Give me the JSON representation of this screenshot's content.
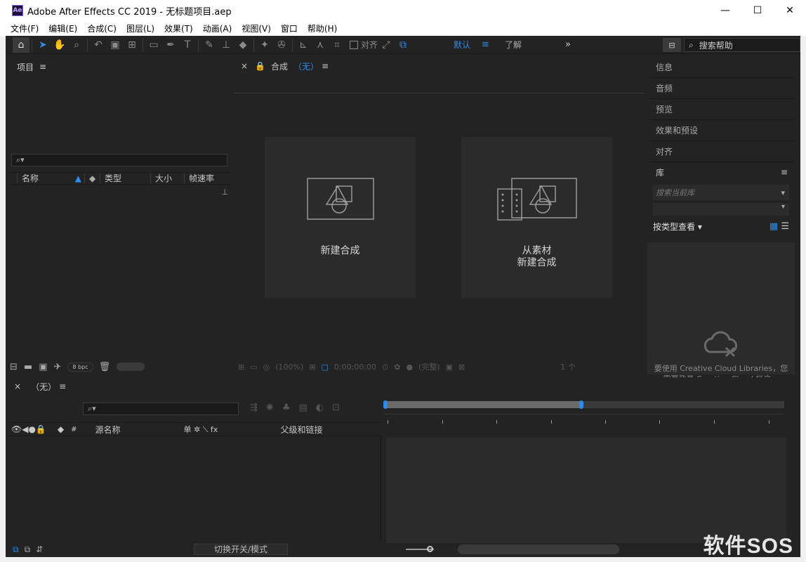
{
  "window": {
    "title": "Adobe After Effects CC 2019 - 无标题项目.aep",
    "app_icon_text": "Ae",
    "minimize": "—",
    "maximize": "☐",
    "close": "✕"
  },
  "menu": [
    "文件(F)",
    "编辑(E)",
    "合成(C)",
    "图层(L)",
    "效果(T)",
    "动画(A)",
    "视图(V)",
    "窗口",
    "帮助(H)"
  ],
  "toolbar": {
    "align_label": "对齐",
    "workspace_default": "默认",
    "workspace_menu": "≡",
    "workspace_learn": "了解",
    "more": "»",
    "search_help_placeholder": "搜索帮助"
  },
  "project": {
    "title": "项目",
    "menu": "≡",
    "search": "⌕▾",
    "columns": [
      "名称",
      "类型",
      "大小",
      "帧速率"
    ],
    "bpc": "8 bpc"
  },
  "composition": {
    "close": "×",
    "title": "合成",
    "name": "（无）",
    "menu": "≡",
    "tile_new": "新建合成",
    "tile_from_footage_line1": "从素材",
    "tile_from_footage_line2": "新建合成",
    "footer_zoom": "(100%)",
    "footer_time": "0;00;00;00",
    "footer_quality": "(完整)",
    "footer_views": "1 个"
  },
  "right_panels": {
    "tabs": [
      "信息",
      "音频",
      "预览",
      "效果和预设",
      "对齐"
    ],
    "library": {
      "title": "库",
      "menu": "≡",
      "search_placeholder": "搜索当前库",
      "view_by_type": "按类型查看",
      "message_line1": "要使用 Creative Cloud Libraries，您",
      "message_line2": "需要登录 Creative Cloud 帐户。"
    }
  },
  "timeline": {
    "close": "×",
    "name": "（无）",
    "menu": "≡",
    "search": "⌕▾",
    "col_hash": "#",
    "col_source": "源名称",
    "col_switches": "单 ✲ ⟍ fx",
    "col_parent": "父级和链接",
    "toggle_switches": "切换开关/模式"
  },
  "watermark": "软件SOS",
  "colors": {
    "accent": "#2d8ceb",
    "panel_bg": "#232323",
    "tile_bg": "#2b2b2b"
  }
}
